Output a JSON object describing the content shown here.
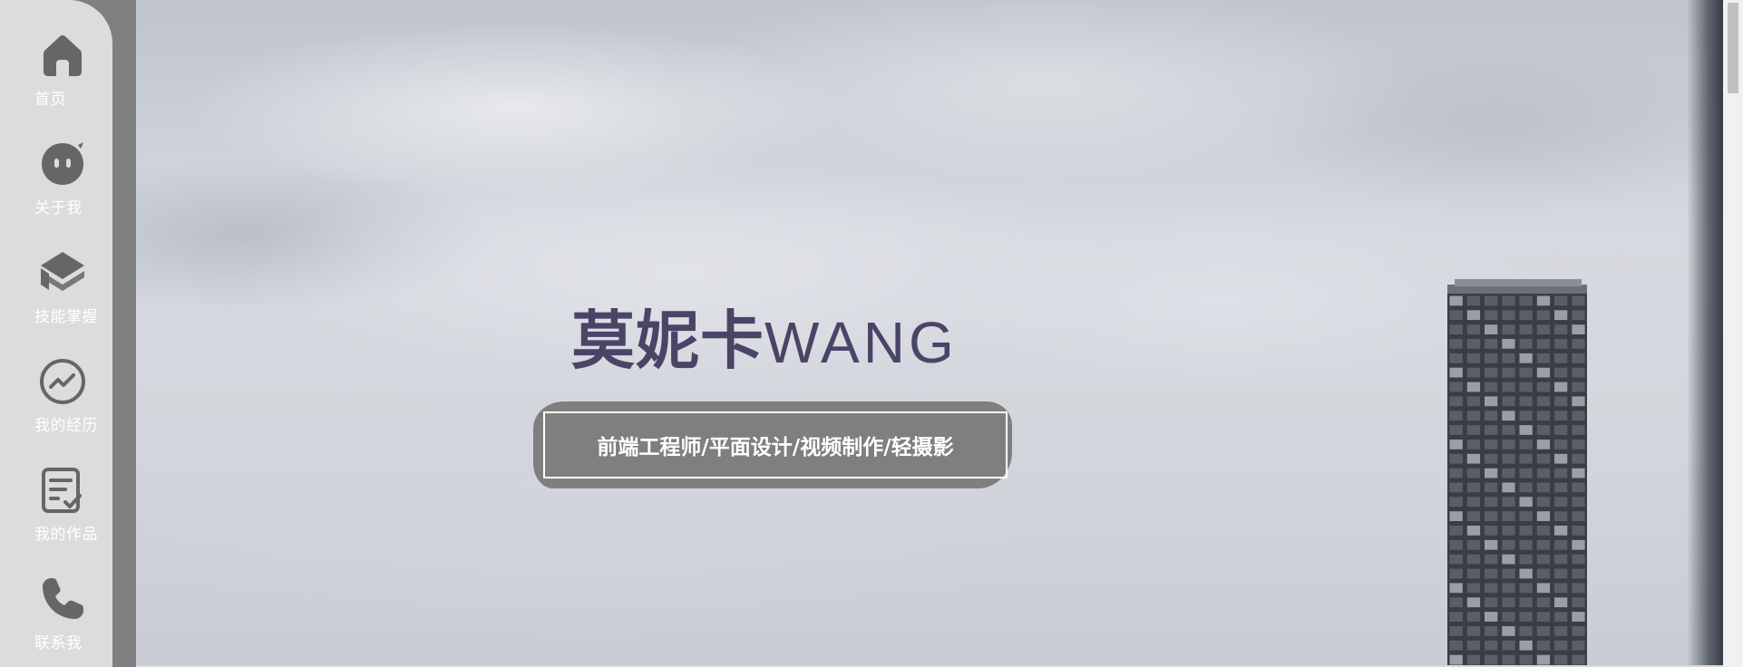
{
  "sidebar": {
    "items": [
      {
        "label": "首页",
        "icon": "home-icon"
      },
      {
        "label": "关于我",
        "icon": "face-icon"
      },
      {
        "label": "技能掌握",
        "icon": "layers-icon"
      },
      {
        "label": "我的经历",
        "icon": "trend-icon"
      },
      {
        "label": "我的作品",
        "icon": "document-check-icon"
      },
      {
        "label": "联系我",
        "icon": "phone-icon"
      }
    ]
  },
  "hero": {
    "name_cn": "莫妮卡",
    "name_en": "WANG",
    "tagline": "前端工程师/平面设计/视频制作/轻摄影"
  },
  "colors": {
    "sidebar_bg": "#dcdcdc",
    "sidebar_strip": "#808080",
    "icon": "#666666",
    "title": "#4a4466",
    "tagline_bg": "#7f7f7f"
  }
}
